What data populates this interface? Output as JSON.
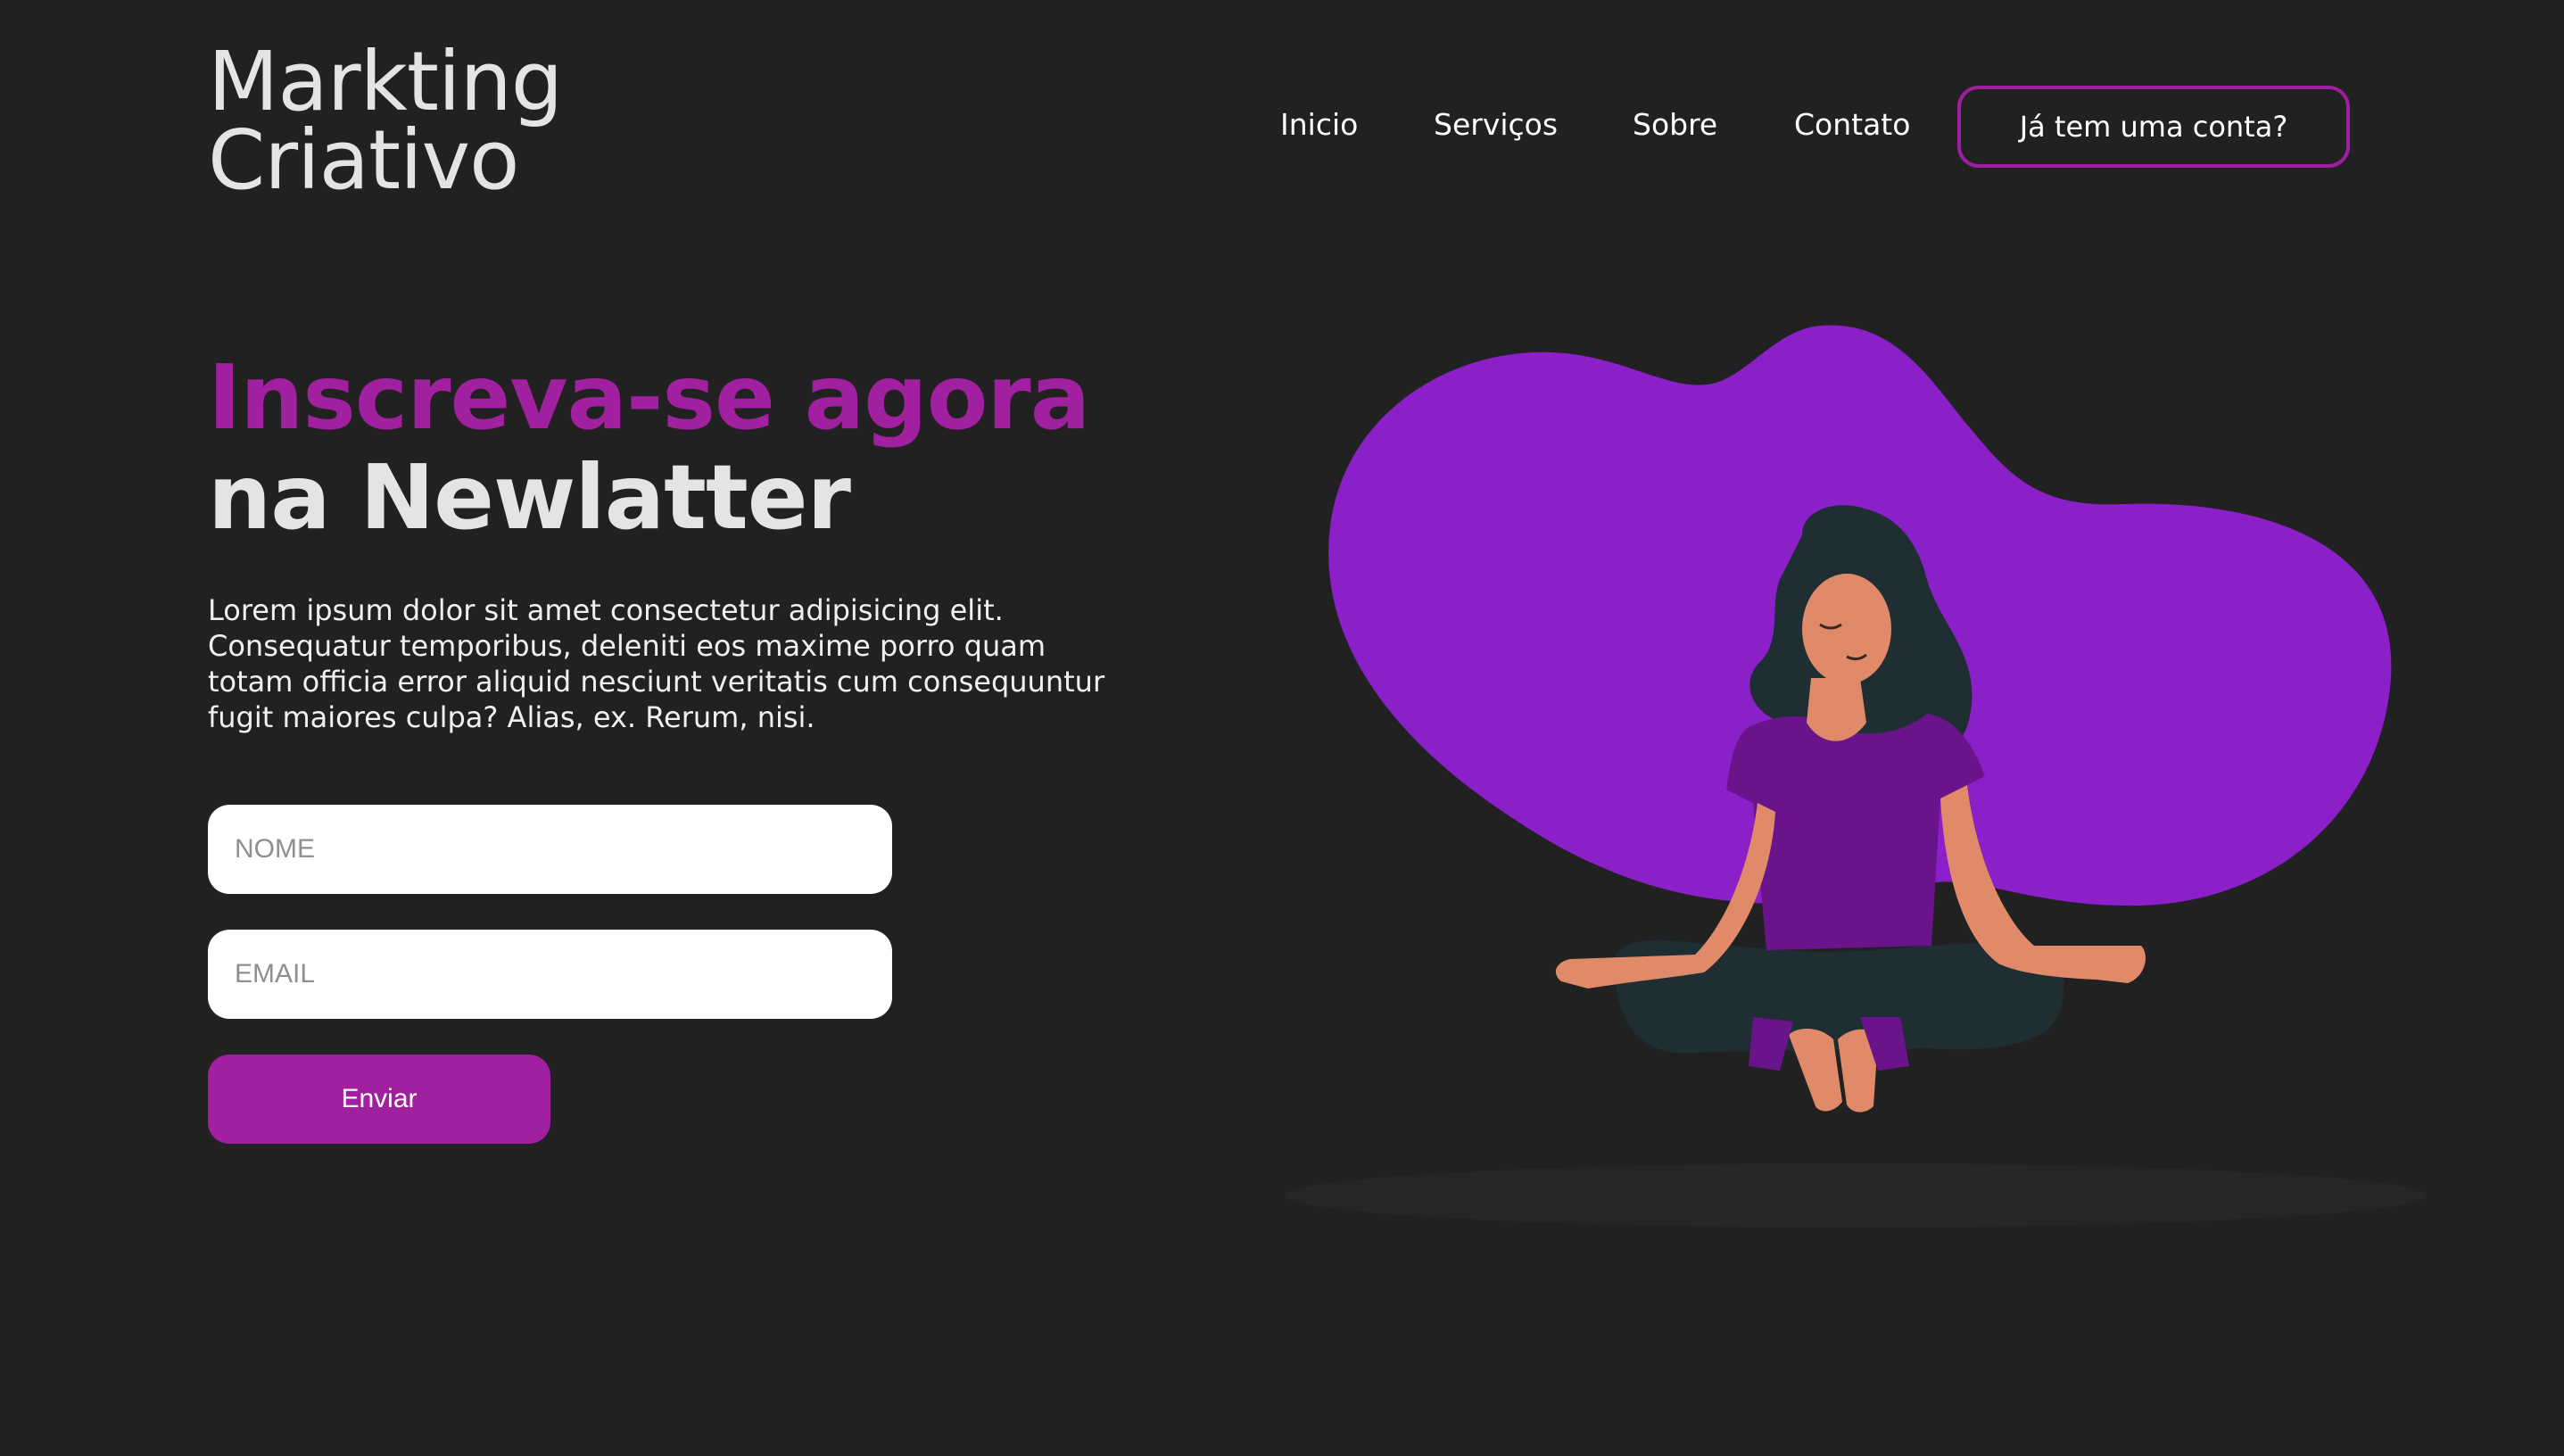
{
  "header": {
    "logo_line1": "Markting",
    "logo_line2": "Criativo",
    "nav": [
      {
        "label": "Inicio"
      },
      {
        "label": "Serviços"
      },
      {
        "label": "Sobre"
      },
      {
        "label": "Contato"
      }
    ],
    "account_button": "Já tem uma conta?"
  },
  "hero": {
    "title_line1": "Inscreva-se agora",
    "title_line2": "na Newlatter",
    "description": "Lorem ipsum dolor sit amet consectetur adipisicing elit. Consequatur temporibus, deleniti eos maxime porro quam totam officia error aliquid nesciunt veritatis cum consequuntur fugit maiores culpa? Alias, ex. Rerum, nisi."
  },
  "form": {
    "name_placeholder": "NOME",
    "email_placeholder": "EMAIL",
    "submit_label": "Enviar"
  },
  "colors": {
    "background": "#212121",
    "accent": "#a020a0",
    "blob": "#8b1fc8"
  },
  "illustration": {
    "subject": "woman-meditating-illustration"
  }
}
